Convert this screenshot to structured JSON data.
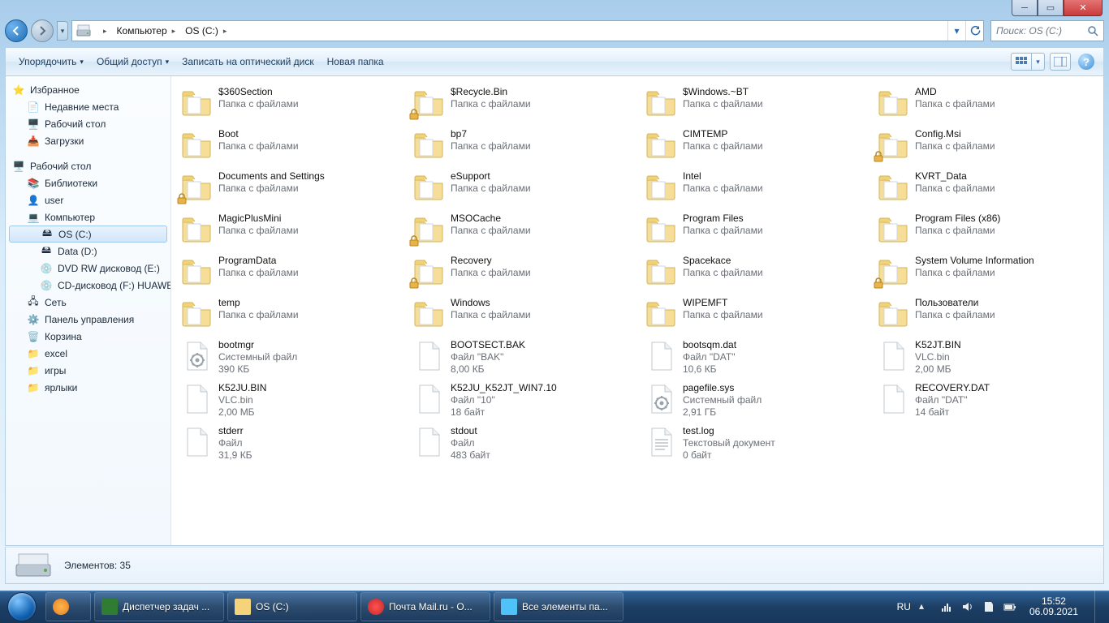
{
  "breadcrumbs": [
    {
      "label": "Компьютер"
    },
    {
      "label": "OS (C:)"
    }
  ],
  "search": {
    "placeholder": "Поиск: OS (C:)"
  },
  "toolbar": {
    "organize": "Упорядочить",
    "share": "Общий доступ",
    "burn": "Записать на оптический диск",
    "newfolder": "Новая папка"
  },
  "tree": {
    "favorites": "Избранное",
    "recent": "Недавние места",
    "desktop_fav": "Рабочий стол",
    "downloads": "Загрузки",
    "desktop": "Рабочий стол",
    "libraries": "Библиотеки",
    "user": "user",
    "computer": "Компьютер",
    "osc": "OS (C:)",
    "datad": "Data (D:)",
    "dvde": "DVD RW дисковод (E:)",
    "cdf": "CD-дисковод (F:) HUAWEI M",
    "network": "Сеть",
    "controlpanel": "Панель управления",
    "bin": "Корзина",
    "excel": "excel",
    "games": "игры",
    "shortcuts": "ярлыки"
  },
  "items": [
    {
      "name": "$360Section",
      "l2": "Папка с файлами",
      "type": "folder"
    },
    {
      "name": "$Recycle.Bin",
      "l2": "Папка с файлами",
      "type": "folder",
      "lock": true
    },
    {
      "name": "$Windows.~BT",
      "l2": "Папка с файлами",
      "type": "folder"
    },
    {
      "name": "AMD",
      "l2": "Папка с файлами",
      "type": "folder"
    },
    {
      "name": "Boot",
      "l2": "Папка с файлами",
      "type": "folder"
    },
    {
      "name": "bp7",
      "l2": "Папка с файлами",
      "type": "folder"
    },
    {
      "name": "CIMTEMP",
      "l2": "Папка с файлами",
      "type": "folder"
    },
    {
      "name": "Config.Msi",
      "l2": "Папка с файлами",
      "type": "folder",
      "lock": true
    },
    {
      "name": "Documents and Settings",
      "l2": "Папка с файлами",
      "type": "folder",
      "lock": true
    },
    {
      "name": "eSupport",
      "l2": "Папка с файлами",
      "type": "folder"
    },
    {
      "name": "Intel",
      "l2": "Папка с файлами",
      "type": "folder"
    },
    {
      "name": "KVRT_Data",
      "l2": "Папка с файлами",
      "type": "folder"
    },
    {
      "name": "MagicPlusMini",
      "l2": "Папка с файлами",
      "type": "folder"
    },
    {
      "name": "MSOCache",
      "l2": "Папка с файлами",
      "type": "folder",
      "lock": true
    },
    {
      "name": "Program Files",
      "l2": "Папка с файлами",
      "type": "folder"
    },
    {
      "name": "Program Files (x86)",
      "l2": "Папка с файлами",
      "type": "folder"
    },
    {
      "name": "ProgramData",
      "l2": "Папка с файлами",
      "type": "folder"
    },
    {
      "name": "Recovery",
      "l2": "Папка с файлами",
      "type": "folder",
      "lock": true
    },
    {
      "name": "Spacekace",
      "l2": "Папка с файлами",
      "type": "folder"
    },
    {
      "name": "System Volume Information",
      "l2": "Папка с файлами",
      "type": "folder",
      "lock": true
    },
    {
      "name": "temp",
      "l2": "Папка с файлами",
      "type": "folder"
    },
    {
      "name": "Windows",
      "l2": "Папка с файлами",
      "type": "folder"
    },
    {
      "name": "WIPEMFT",
      "l2": "Папка с файлами",
      "type": "folder"
    },
    {
      "name": "Пользователи",
      "l2": "Папка с файлами",
      "type": "folder"
    },
    {
      "name": "bootmgr",
      "l2": "Системный файл",
      "l3": "390 КБ",
      "type": "sys"
    },
    {
      "name": "BOOTSECT.BAK",
      "l2": "Файл \"BAK\"",
      "l3": "8,00 КБ",
      "type": "file"
    },
    {
      "name": "bootsqm.dat",
      "l2": "Файл \"DAT\"",
      "l3": "10,6 КБ",
      "type": "file"
    },
    {
      "name": "K52JT.BIN",
      "l2": "VLC.bin",
      "l3": "2,00 МБ",
      "type": "file"
    },
    {
      "name": "K52JU.BIN",
      "l2": "VLC.bin",
      "l3": "2,00 МБ",
      "type": "file"
    },
    {
      "name": "K52JU_K52JT_WIN7.10",
      "l2": "Файл \"10\"",
      "l3": "18 байт",
      "type": "file"
    },
    {
      "name": "pagefile.sys",
      "l2": "Системный файл",
      "l3": "2,91 ГБ",
      "type": "sys"
    },
    {
      "name": "RECOVERY.DAT",
      "l2": "Файл \"DAT\"",
      "l3": "14 байт",
      "type": "file"
    },
    {
      "name": "stderr",
      "l2": "Файл",
      "l3": "31,9 КБ",
      "type": "file"
    },
    {
      "name": "stdout",
      "l2": "Файл",
      "l3": "483 байт",
      "type": "file"
    },
    {
      "name": "test.log",
      "l2": "Текстовый документ",
      "l3": "0 байт",
      "type": "txt"
    }
  ],
  "status": {
    "label": "Элементов: 35"
  },
  "taskbar": {
    "t1": "Диспетчер задач ...",
    "t2": "OS (C:)",
    "t3": "Почта Mail.ru - O...",
    "t4": "Все элементы па..."
  },
  "tray": {
    "lang": "RU",
    "time": "15:52",
    "date": "06.09.2021"
  }
}
